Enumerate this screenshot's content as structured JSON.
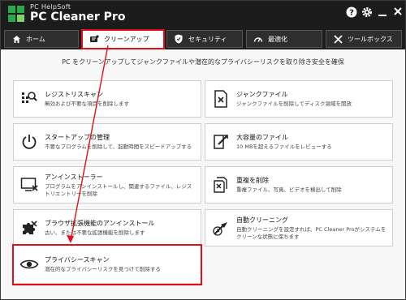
{
  "app": {
    "brand_small": "PC HelpSoft",
    "brand_big": "PC Cleaner Pro"
  },
  "titlebar_icons": [
    "help-icon",
    "gear-icon",
    "minimize-icon",
    "close-icon"
  ],
  "tabs": [
    {
      "label": "ホーム",
      "icon": "home-icon",
      "active": false
    },
    {
      "label": "クリーンアップ",
      "icon": "broom-icon",
      "active": true
    },
    {
      "label": "セキュリティ",
      "icon": "shield-icon",
      "active": false
    },
    {
      "label": "最適化",
      "icon": "gauge-icon",
      "active": false
    },
    {
      "label": "ツールボックス",
      "icon": "tools-icon",
      "active": false
    }
  ],
  "subtitle": "PC をクリーンアップしてジャンクファイルや潜在的なプライバシーリスクを取り除き安全を確保",
  "cards": [
    {
      "title": "レジストリスキャン",
      "desc": "無効および不要な項目を削除します",
      "icon": "registry-scan-icon"
    },
    {
      "title": "ジャンクファイル",
      "desc": "ジャンクファイルを削除してディスク領域を開放",
      "icon": "junk-file-icon"
    },
    {
      "title": "スタートアップの管理",
      "desc": "不要なプログラムを削除して、起動時間をスピードアップする",
      "icon": "power-icon"
    },
    {
      "title": "大容量のファイル",
      "desc": "10 MBを超えるファイルをレビューする",
      "icon": "large-file-icon"
    },
    {
      "title": "アンインストーラー",
      "desc": "プログラムをアンインストールし、関連するファイル、レジストリエントリーを削除",
      "icon": "uninstall-icon"
    },
    {
      "title": "重複を削除",
      "desc": "重複ファイル、写真、ビデオを検出して削除",
      "icon": "duplicate-icon"
    },
    {
      "title": "ブラウザ拡張機能のアンインストール",
      "desc": "古い、または不要な拡張機能を削除します",
      "icon": "puzzle-icon"
    },
    {
      "title": "自動クリーニング",
      "desc": "自動クリーニングを設定すれば、PC Cleaner Proがシステムをクリーンな状態に保ちます",
      "icon": "auto-clean-icon"
    },
    {
      "title": "プライバシースキャン",
      "desc": "潜在的なプライバシーリスクを見つけて削除する",
      "icon": "eye-icon"
    }
  ],
  "colors": {
    "titlebar": "#1c1c1c",
    "highlight": "#e0101a"
  }
}
